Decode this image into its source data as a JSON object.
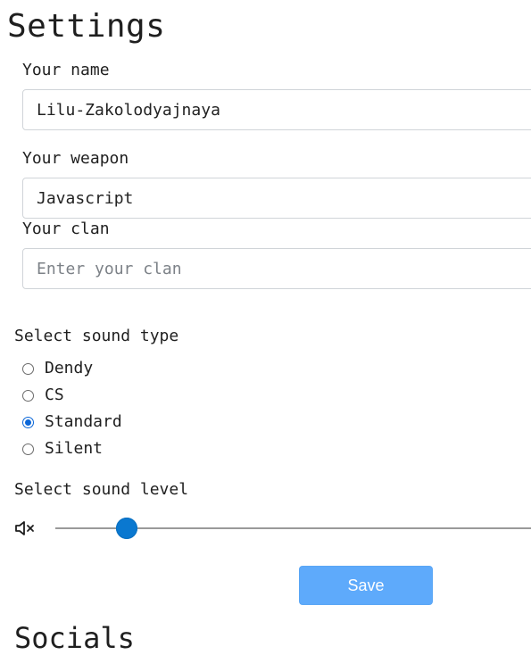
{
  "page": {
    "title": "Settings"
  },
  "form": {
    "name": {
      "label": "Your name",
      "value": "Lilu-Zakolodyajnaya",
      "placeholder": ""
    },
    "weapon": {
      "label": "Your weapon",
      "value": "Javascript",
      "placeholder": ""
    },
    "clan": {
      "label": "Your clan",
      "value": "",
      "placeholder": "Enter your clan"
    }
  },
  "sound_type": {
    "label": "Select sound type",
    "options": [
      {
        "label": "Dendy",
        "checked": false
      },
      {
        "label": "CS",
        "checked": false
      },
      {
        "label": "Standard",
        "checked": true
      },
      {
        "label": "Silent",
        "checked": false
      }
    ],
    "selected": "Standard"
  },
  "sound_level": {
    "label": "Select sound level",
    "icon": "volume-mute-icon",
    "value_fraction": 0.15
  },
  "actions": {
    "save_label": "Save"
  },
  "socials": {
    "title": "Socials"
  },
  "colors": {
    "accent": "#0a78d0",
    "button_bg": "#5eaafb",
    "input_border": "#d0d4d8"
  }
}
